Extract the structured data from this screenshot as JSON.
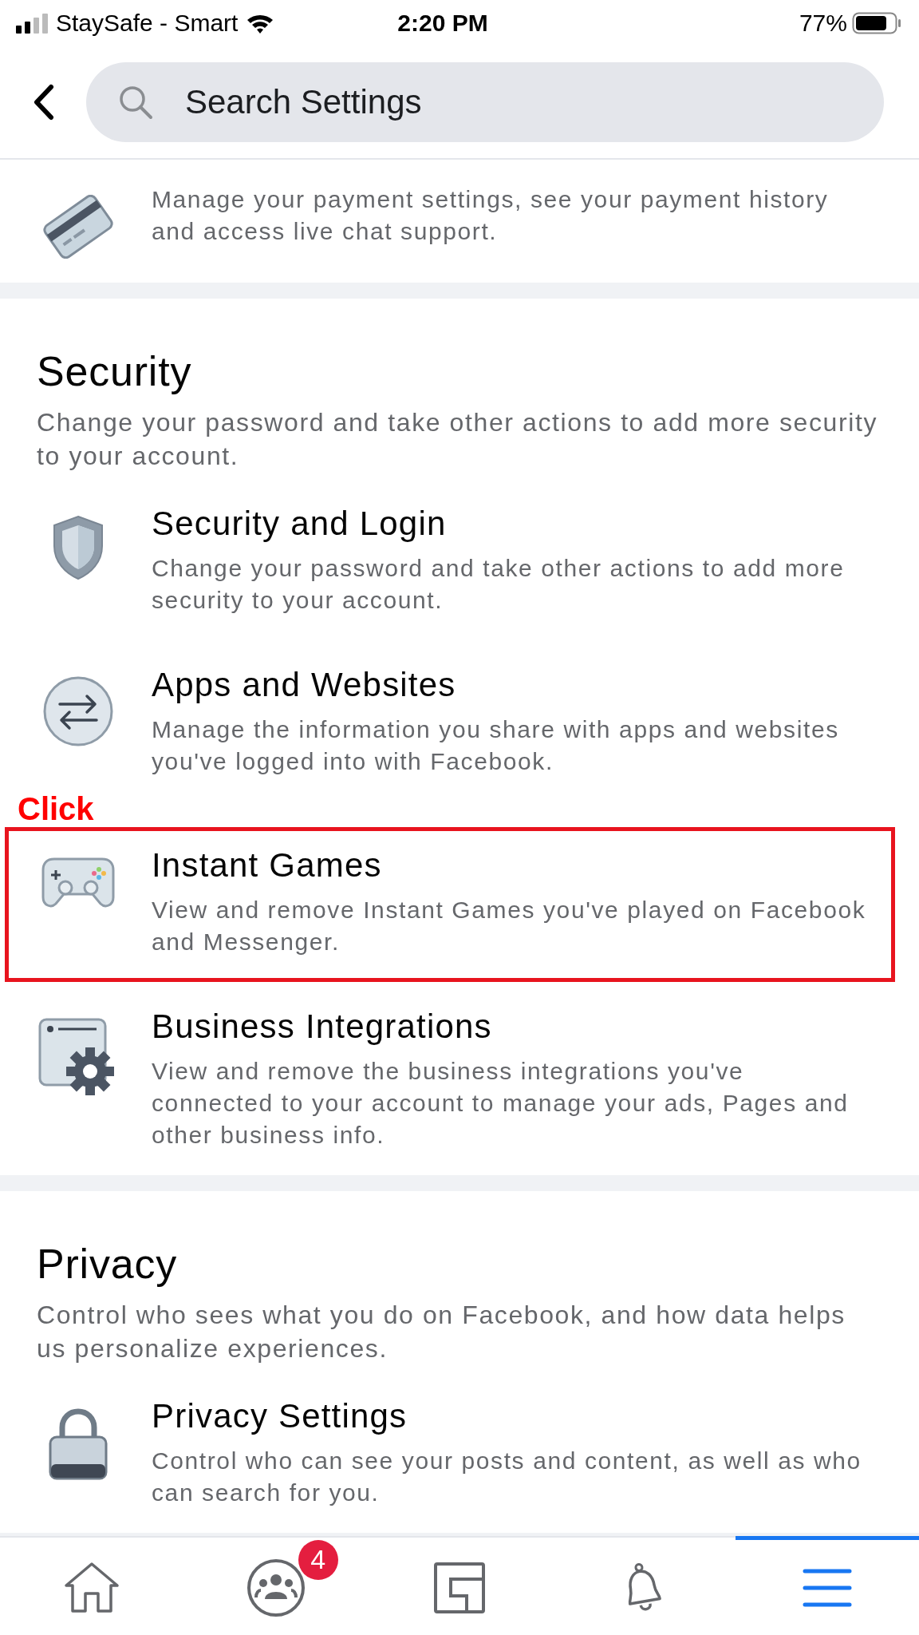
{
  "status_bar": {
    "carrier": "StaySafe - Smart",
    "time": "2:20 PM",
    "battery": "77%"
  },
  "search": {
    "placeholder": "Search Settings"
  },
  "sections": [
    {
      "rows": [
        {
          "kind": "card",
          "description": "Manage your payment settings, see your payment history and access live chat support.",
          "highlighted": false
        }
      ]
    },
    {
      "title": "Security",
      "description": "Change your password and take other actions to add more security to your account.",
      "rows": [
        {
          "kind": "shield",
          "title": "Security and Login",
          "description": "Change your password and take other actions to add more security to your account.",
          "highlighted": false
        },
        {
          "kind": "arrows",
          "title": "Apps and Websites",
          "description": "Manage the information you share with apps and websites you've logged into with Facebook.",
          "highlighted": false
        },
        {
          "kind": "gamepad",
          "title": "Instant Games",
          "description": "View and remove Instant Games you've played on Facebook and Messenger.",
          "highlighted": true,
          "annotation": "Click"
        },
        {
          "kind": "browser-gear",
          "title": "Business Integrations",
          "description": "View and remove the business integrations you've connected to your account to manage your ads, Pages and other business info.",
          "highlighted": false
        }
      ]
    },
    {
      "title": "Privacy",
      "description": "Control who sees what you do on Facebook, and how data helps us personalize experiences.",
      "rows": [
        {
          "kind": "lock",
          "title": "Privacy Settings",
          "description": "Control who can see your posts and content, as well as who can search for you.",
          "highlighted": false
        }
      ]
    }
  ],
  "bottom_nav": [
    {
      "kind": "home",
      "selected": false
    },
    {
      "kind": "groups",
      "badge": "4",
      "selected": false
    },
    {
      "kind": "feed",
      "selected": false
    },
    {
      "kind": "bell",
      "selected": false
    },
    {
      "kind": "menu",
      "selected": true
    }
  ]
}
